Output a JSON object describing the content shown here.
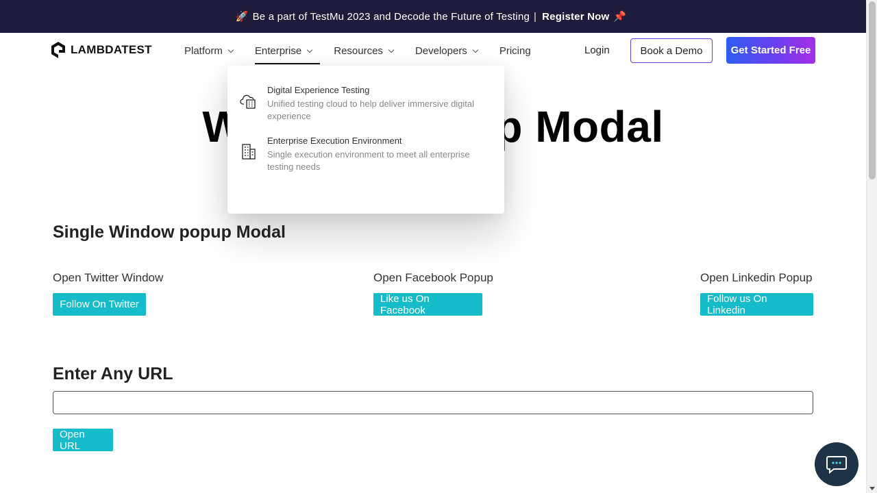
{
  "announcement": {
    "rocket": "🚀",
    "text": "Be a part of TestMu 2023 and Decode the Future of Testing",
    "separator": "|",
    "cta": "Register Now",
    "pin": "📌"
  },
  "nav": {
    "logo_text": "LAMBDATEST",
    "items": [
      {
        "label": "Platform",
        "has_dropdown": true
      },
      {
        "label": "Enterprise",
        "has_dropdown": true,
        "active": true
      },
      {
        "label": "Resources",
        "has_dropdown": true
      },
      {
        "label": "Developers",
        "has_dropdown": true
      },
      {
        "label": "Pricing",
        "has_dropdown": false
      }
    ],
    "login": "Login",
    "book_demo": "Book a Demo",
    "get_started": "Get Started Free"
  },
  "dropdown": {
    "items": [
      {
        "title": "Digital Experience Testing",
        "desc": "Unified testing cloud to help deliver immersive digital experience",
        "icon": "cloud-building-icon"
      },
      {
        "title": "Enterprise Execution Environment",
        "desc": "Single execution environment to meet all enterprise testing needs",
        "icon": "building-icon"
      }
    ]
  },
  "hero": {
    "title": "Window Popup Modal"
  },
  "single_window": {
    "title": "Single Window popup Modal",
    "twitter_label": "Open Twitter Window",
    "twitter_button": "Follow On Twitter",
    "facebook_label": "Open Facebook Popup",
    "facebook_button": "Like us On Facebook",
    "linkedin_label": "Open Linkedin Popup",
    "linkedin_button": "Follow us On Linkedin"
  },
  "url_section": {
    "title": "Enter Any URL",
    "input_value": "",
    "button": "Open URL"
  },
  "colors": {
    "announcement_bg": "#1f1b3a",
    "accent_button": "#17bcca",
    "chat_bg": "#1e3346"
  }
}
